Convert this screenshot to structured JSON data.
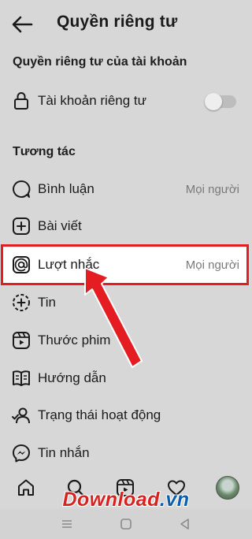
{
  "header": {
    "title": "Quyền riêng tư"
  },
  "account_section": {
    "heading": "Quyền riêng tư của tài khoản",
    "private_account": {
      "label": "Tài khoản riêng tư",
      "toggle_on": false
    }
  },
  "interactions": {
    "heading": "Tương tác",
    "items": [
      {
        "label": "Bình luận",
        "value": "Mọi người",
        "icon": "comment-icon"
      },
      {
        "label": "Bài viết",
        "value": "",
        "icon": "plus-square-icon"
      },
      {
        "label": "Lượt nhắc",
        "value": "Mọi người",
        "icon": "at-icon"
      },
      {
        "label": "Tin",
        "value": "",
        "icon": "story-icon"
      },
      {
        "label": "Thước phim",
        "value": "",
        "icon": "reels-icon"
      },
      {
        "label": "Hướng dẫn",
        "value": "",
        "icon": "guide-icon"
      },
      {
        "label": "Trạng thái hoạt động",
        "value": "",
        "icon": "activity-user-icon"
      },
      {
        "label": "Tin nhắn",
        "value": "",
        "icon": "messenger-icon"
      }
    ]
  },
  "bottom_nav": [
    "home-icon",
    "search-icon",
    "reels-icon",
    "heart-icon",
    "profile-avatar"
  ],
  "watermark": {
    "part1": "Download",
    "part2": ".vn"
  },
  "colors": {
    "background": "#d7d7d7",
    "highlight": "#e41d23",
    "arrow": "#e41d23"
  }
}
